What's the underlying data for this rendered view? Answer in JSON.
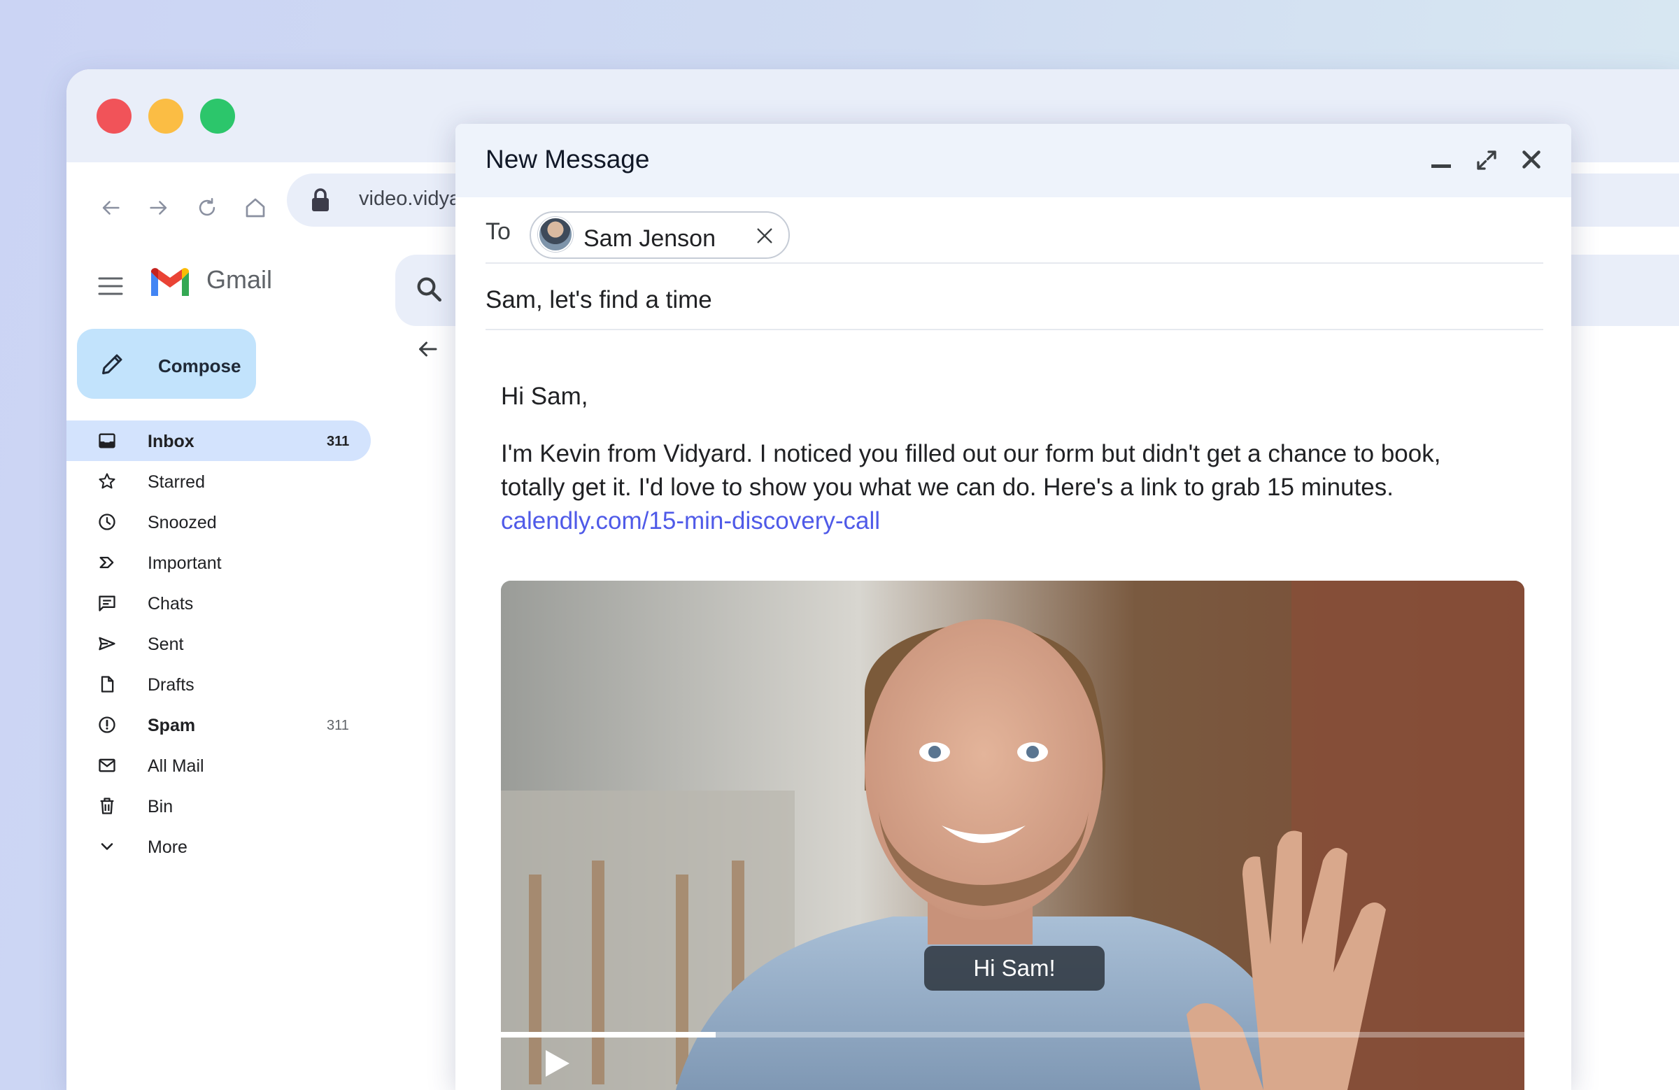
{
  "browser": {
    "url": "video.vidyard.com"
  },
  "gmail": {
    "app_name": "Gmail",
    "compose_label": "Compose",
    "nav": [
      {
        "label": "Inbox",
        "count": "311",
        "icon": "inbox-icon",
        "active": true,
        "bold": true
      },
      {
        "label": "Starred",
        "count": "",
        "icon": "star-icon"
      },
      {
        "label": "Snoozed",
        "count": "",
        "icon": "clock-icon"
      },
      {
        "label": "Important",
        "count": "",
        "icon": "important-icon"
      },
      {
        "label": "Chats",
        "count": "",
        "icon": "chat-icon"
      },
      {
        "label": "Sent",
        "count": "",
        "icon": "send-icon"
      },
      {
        "label": "Drafts",
        "count": "",
        "icon": "draft-icon"
      },
      {
        "label": "Spam",
        "count": "311",
        "icon": "spam-icon",
        "bold": true
      },
      {
        "label": "All Mail",
        "count": "",
        "icon": "mail-icon"
      },
      {
        "label": "Bin",
        "count": "",
        "icon": "trash-icon"
      },
      {
        "label": "More",
        "count": "",
        "icon": "chevron-down-icon"
      }
    ]
  },
  "compose": {
    "title": "New Message",
    "to_label": "To",
    "recipient": "Sam Jenson",
    "subject": "Sam, let's find a time",
    "greeting": "Hi Sam,",
    "body": "I'm Kevin from Vidyard. I noticed you filled out our form but didn't get a chance to book, totally get it. I'd love to show you what we can do. Here's a link to grab 15 minutes.",
    "link": "calendly.com/15-min-discovery-call",
    "video": {
      "caption": "Hi Sam!",
      "progress": 0.21
    }
  },
  "colors": {
    "accent_blue": "#c2e3fc",
    "active_nav": "#d3e3fd",
    "link": "#4f5ae8",
    "traffic_red": "#f15359",
    "traffic_yellow": "#fbbd44",
    "traffic_green": "#2cc66b"
  }
}
